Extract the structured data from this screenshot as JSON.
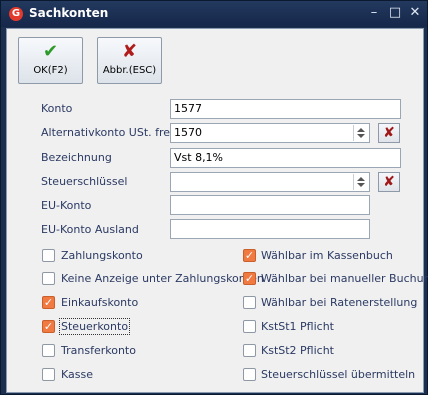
{
  "window": {
    "title": "Sachkonten",
    "logo": "G",
    "min": "–",
    "max": "□",
    "close": "✕"
  },
  "toolbar": {
    "ok": {
      "icon": "✔",
      "label": "OK(F2)"
    },
    "cancel": {
      "icon": "✘",
      "label": "Abbr.(ESC)"
    }
  },
  "fields": {
    "konto": {
      "label": "Konto",
      "value": "1577"
    },
    "alternativ": {
      "label": "Alternativkonto  USt. frei",
      "value": "1570"
    },
    "bezeichnung": {
      "label": "Bezeichnung",
      "value": "Vst 8,1%"
    },
    "steuer": {
      "label": "Steuerschlüssel",
      "value": ""
    },
    "eu": {
      "label": "EU-Konto",
      "value": ""
    },
    "eu_ausland": {
      "label": "EU-Konto Ausland",
      "value": ""
    }
  },
  "checkboxes_left": [
    {
      "label": "Zahlungskonto",
      "checked": false
    },
    {
      "label": "Keine Anzeige unter Zahlungskonten",
      "checked": false
    },
    {
      "label": "Einkaufskonto",
      "checked": true
    },
    {
      "label": "Steuerkonto",
      "checked": true
    },
    {
      "label": "Transferkonto",
      "checked": false
    },
    {
      "label": "Kasse",
      "checked": false
    }
  ],
  "checkboxes_right": [
    {
      "label": "Wählbar im Kassenbuch",
      "checked": true
    },
    {
      "label": "Wählbar bei manueller Buchung",
      "checked": true
    },
    {
      "label": "Wählbar bei Ratenerstellung",
      "checked": false
    },
    {
      "label": "KstSt1 Pflicht",
      "checked": false
    },
    {
      "label": "KstSt2 Pflicht",
      "checked": false
    },
    {
      "label": "Steuerschlüssel übermitteln",
      "checked": false
    }
  ],
  "colors": {
    "accent": "#f07a42",
    "label_text": "#2b3a63",
    "clear_x": "#a01818"
  },
  "icons": {
    "clear": "✘",
    "check": "✓"
  }
}
